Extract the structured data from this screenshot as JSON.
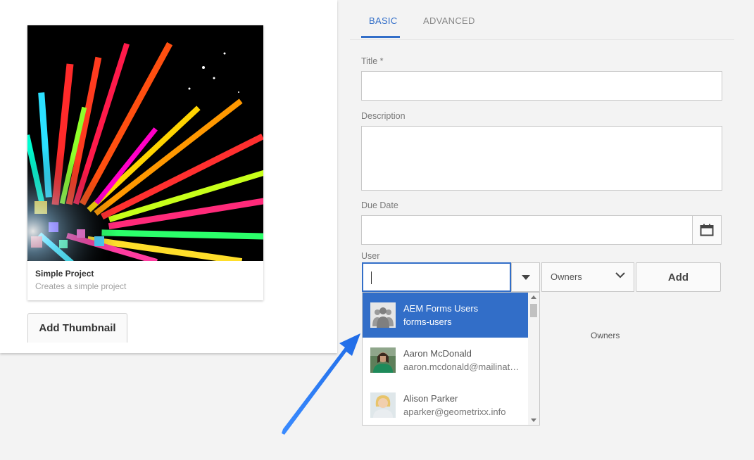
{
  "project_card": {
    "title": "Simple Project",
    "description": "Creates a simple project",
    "add_thumbnail_label": "Add Thumbnail"
  },
  "tabs": [
    {
      "label": "BASIC",
      "active": true
    },
    {
      "label": "ADVANCED",
      "active": false
    }
  ],
  "form": {
    "title_label": "Title *",
    "title_value": "",
    "description_label": "Description",
    "description_value": "",
    "due_date_label": "Due Date",
    "due_date_value": "",
    "user_label": "User",
    "user_value": "",
    "role_selected": "Owners",
    "add_label": "Add",
    "owners_column_header": "Owners"
  },
  "user_dropdown": [
    {
      "name": "AEM Forms Users",
      "sub": "forms-users",
      "selected": true,
      "avatar": "group-avatar"
    },
    {
      "name": "Aaron McDonald",
      "sub": "aaron.mcdonald@mailinator.com",
      "selected": false,
      "avatar": "user-photo"
    },
    {
      "name": "Alison Parker",
      "sub": "aparker@geometrixx.info",
      "selected": false,
      "avatar": "user-photo"
    }
  ],
  "colors": {
    "accent": "#326ec8",
    "annotation_arrow": "#2f7bf0"
  },
  "icons": {
    "calendar": "calendar-icon",
    "dropdown_toggle": "caret-down-icon",
    "role_chevron": "chevron-down-icon"
  }
}
